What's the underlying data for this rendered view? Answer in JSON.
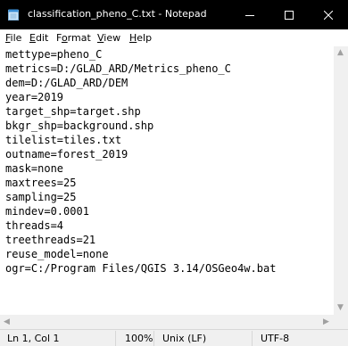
{
  "window": {
    "title": "classification_pheno_C.txt - Notepad",
    "icon": "notepad-icon",
    "controls": {
      "minimize": "minimize-icon",
      "maximize": "maximize-icon",
      "close": "close-icon"
    }
  },
  "menu": {
    "file": {
      "underline": "F",
      "rest": "ile"
    },
    "edit": {
      "underline": "E",
      "rest": "dit"
    },
    "format": {
      "before": "F",
      "underline": "o",
      "rest": "rmat"
    },
    "view": {
      "underline": "V",
      "rest": "iew"
    },
    "help": {
      "underline": "H",
      "rest": "elp"
    }
  },
  "editor": {
    "lines": [
      "mettype=pheno_C",
      "metrics=D:/GLAD_ARD/Metrics_pheno_C",
      "dem=D:/GLAD_ARD/DEM",
      "year=2019",
      "target_shp=target.shp",
      "bkgr_shp=background.shp",
      "tilelist=tiles.txt",
      "outname=forest_2019",
      "mask=none",
      "maxtrees=25",
      "sampling=25",
      "mindev=0.0001",
      "threads=4",
      "treethreads=21",
      "reuse_model=none",
      "ogr=C:/Program Files/QGIS 3.14/OSGeo4w.bat"
    ]
  },
  "status": {
    "position": "Ln 1, Col 1",
    "zoom": "100%",
    "line_ending": "Unix (LF)",
    "encoding": "UTF-8"
  },
  "colors": {
    "titlebar": "#000000",
    "statusbar": "#f0f0f0",
    "scrollbar": "#f0f0f0"
  }
}
